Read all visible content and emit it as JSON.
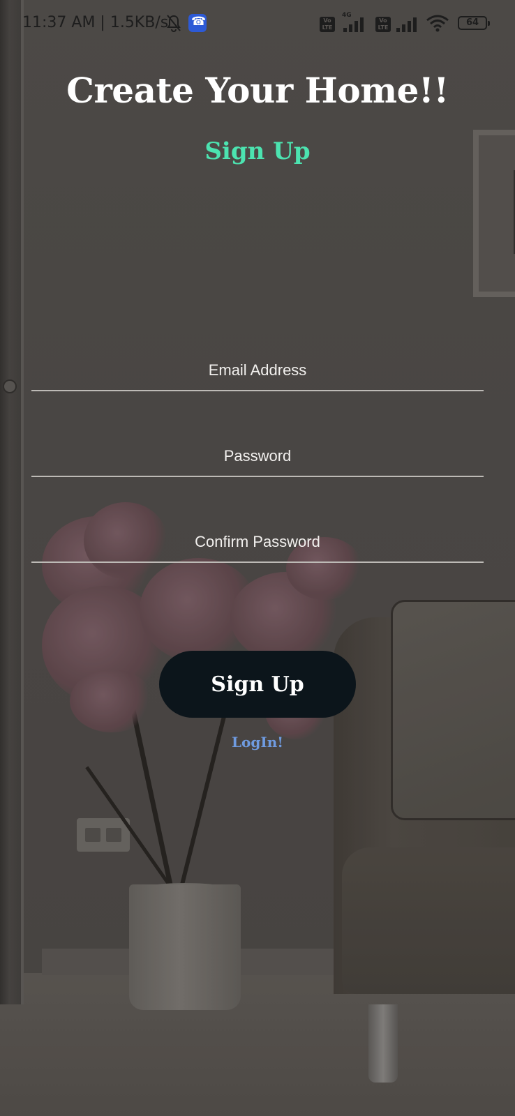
{
  "status_bar": {
    "time": "11:37 AM | 1.5KB/s",
    "volte_label": "Vo LTE",
    "network_type": "4G",
    "battery": "64"
  },
  "header": {
    "title": "Create Your Home!!",
    "subtitle": "Sign Up"
  },
  "form": {
    "email_placeholder": "Email Address",
    "password_placeholder": "Password",
    "confirm_placeholder": "Confirm Password",
    "submit_label": "Sign Up"
  },
  "footer": {
    "login_label": "LogIn!"
  },
  "colors": {
    "accent": "#4ce3b0",
    "button": "#0c151b",
    "link": "#6f9be0"
  }
}
